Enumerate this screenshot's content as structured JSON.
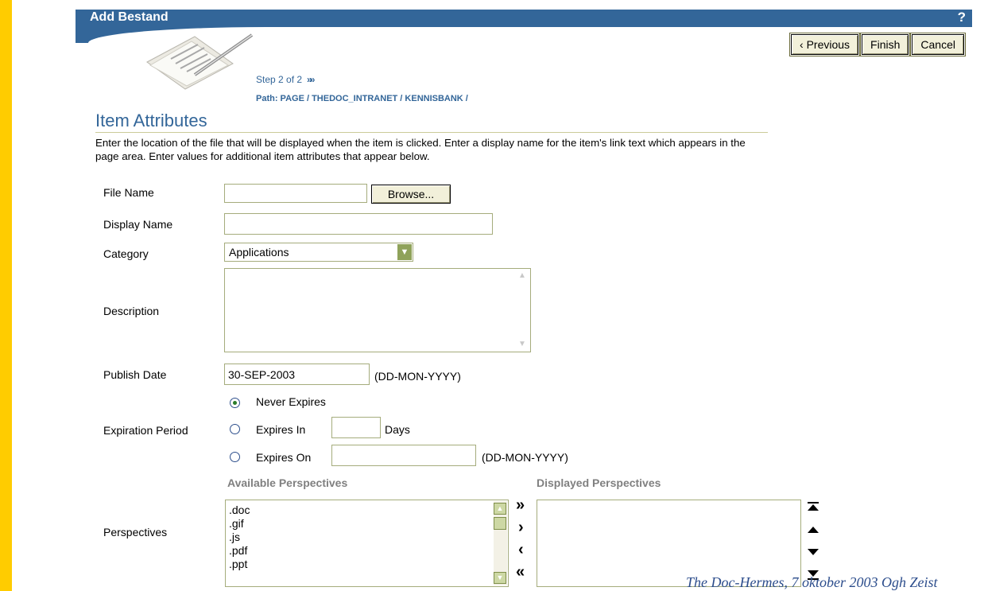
{
  "header": {
    "title": "Add Bestand",
    "help_label": "?"
  },
  "nav": {
    "previous_label": "‹ Previous",
    "finish_label": "Finish",
    "cancel_label": "Cancel"
  },
  "step": {
    "text": "Step 2 of 2",
    "arrows": "»»"
  },
  "path": {
    "text": "Path: PAGE / THEDOC_INTRANET / KENNISBANK /"
  },
  "section": {
    "title": "Item Attributes",
    "instructions": "Enter the location of the file that will be displayed when the item is clicked. Enter a display name for the item's link text which appears in the page area. Enter values for additional item attributes that appear below."
  },
  "form": {
    "file_name": {
      "label": "File Name",
      "value": "",
      "browse_label": "Browse..."
    },
    "display_name": {
      "label": "Display Name",
      "value": ""
    },
    "category": {
      "label": "Category",
      "value": "Applications"
    },
    "description": {
      "label": "Description",
      "value": ""
    },
    "publish_date": {
      "label": "Publish Date",
      "value": "30-SEP-2003",
      "format_hint": "(DD-MON-YYYY)"
    },
    "expiration": {
      "label": "Expiration Period",
      "never_label": "Never Expires",
      "expires_in_label": "Expires In",
      "expires_in_value": "",
      "days_label": "Days",
      "expires_on_label": "Expires On",
      "expires_on_value": "",
      "format_hint": "(DD-MON-YYYY)",
      "selected": "never"
    },
    "perspectives": {
      "label": "Perspectives",
      "available_heading": "Available Perspectives",
      "displayed_heading": "Displayed Perspectives",
      "available": [
        ".doc",
        ".gif",
        ".js",
        ".pdf",
        ".ppt"
      ],
      "displayed": []
    }
  },
  "footer": {
    "text": "The Doc-Hermes, 7 oktober 2003 Ogh Zeist"
  },
  "colors": {
    "frame": "#ffcc00",
    "header": "#336699",
    "accent_green": "#8fa25a"
  }
}
